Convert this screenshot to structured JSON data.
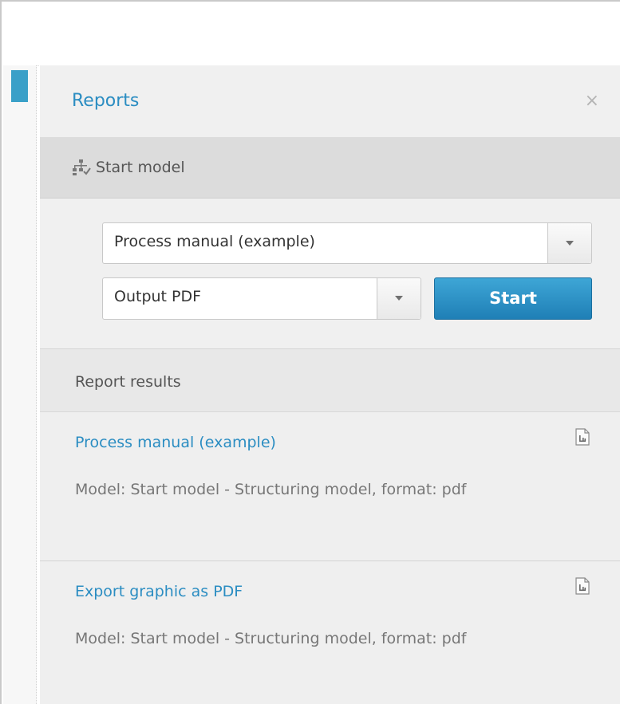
{
  "panel": {
    "title": "Reports",
    "close_glyph": "×"
  },
  "model_section": {
    "icon": "model-hierarchy-icon",
    "label": "Start model"
  },
  "form": {
    "report_select": {
      "value": "Process manual (example)"
    },
    "format_select": {
      "value": "Output PDF"
    },
    "start_label": "Start"
  },
  "results": {
    "header": "Report results",
    "items": [
      {
        "title": "Process manual (example)",
        "description": "Model: Start model - Structuring model, format: pdf",
        "icon": "report-document-icon"
      },
      {
        "title": "Export graphic as PDF",
        "description": "Model: Start model - Structuring model, format: pdf",
        "icon": "report-document-icon"
      }
    ]
  },
  "colors": {
    "accent": "#2b8dc2",
    "button": "#2a8fc6",
    "rail_accent": "#3aa0c8"
  }
}
